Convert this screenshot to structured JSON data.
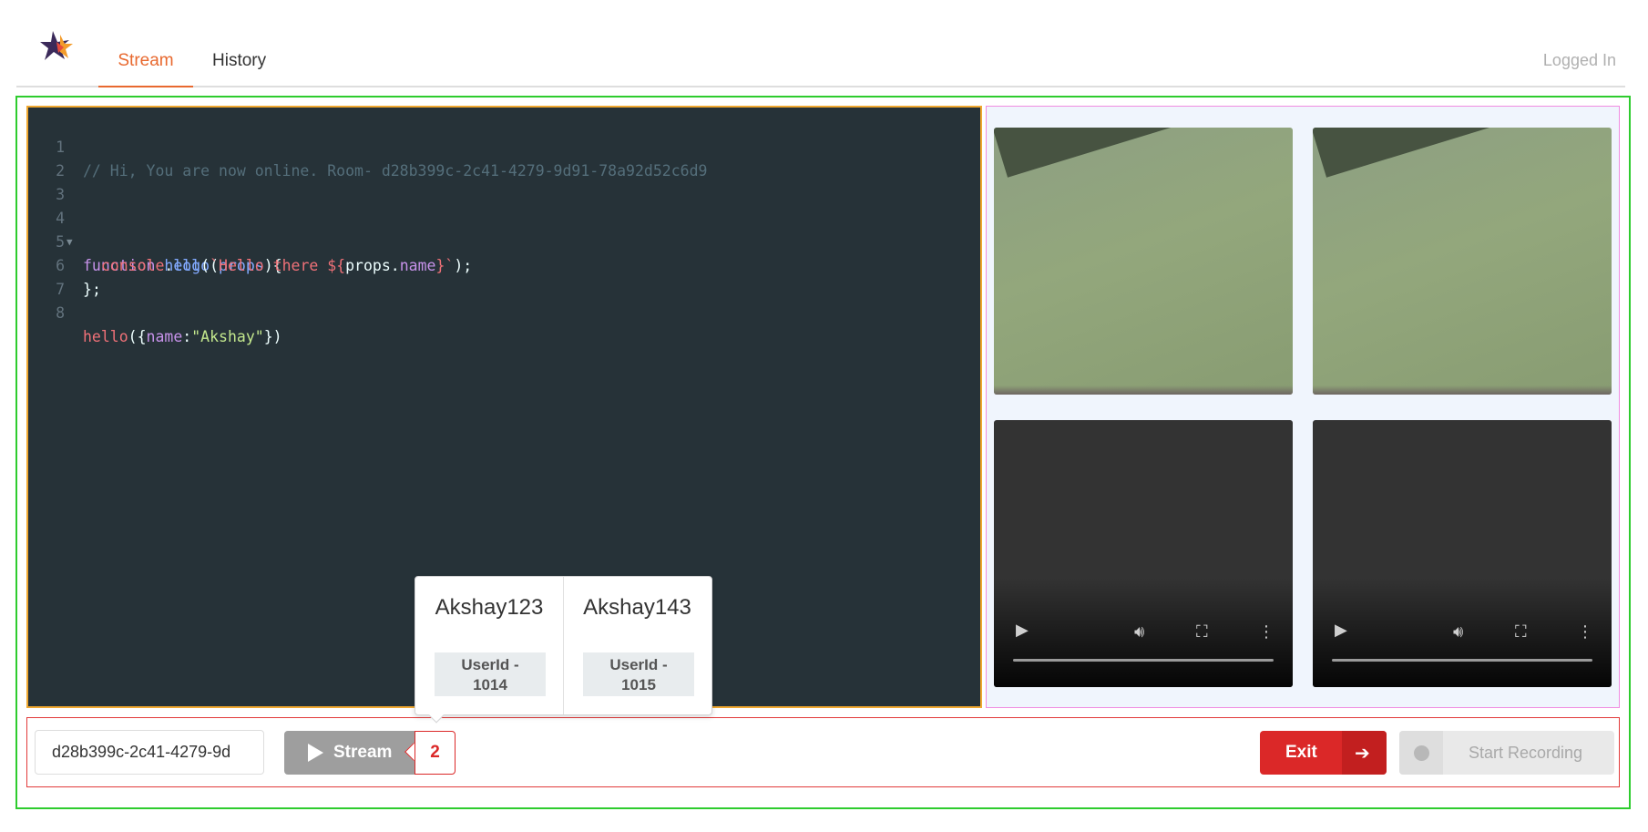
{
  "nav": {
    "tabs": [
      {
        "label": "Stream",
        "active": true
      },
      {
        "label": "History",
        "active": false
      }
    ],
    "status": "Logged In"
  },
  "editor": {
    "lines": [
      {
        "n": "1",
        "text": "// Hi, You are now online. Room- d28b399c-2c41-4279-9d91-78a92d52c6d9"
      },
      {
        "n": "2",
        "text": ""
      },
      {
        "n": "3",
        "text": ""
      },
      {
        "n": "4",
        "text": "function hello(props){"
      },
      {
        "n": "5",
        "text": "  console.log(`Hello there ${props.name}`);"
      },
      {
        "n": "6",
        "text": "};"
      },
      {
        "n": "7",
        "text": ""
      },
      {
        "n": "8",
        "text": "hello({name:\"Akshay\"})"
      }
    ],
    "theme_bg": "#263238"
  },
  "videos": [
    {
      "type": "camera"
    },
    {
      "type": "camera"
    },
    {
      "type": "player"
    },
    {
      "type": "player"
    }
  ],
  "toolbar": {
    "room_input_value": "d28b399c-2c41-4279-9d",
    "stream_label": "Stream",
    "viewer_count": "2",
    "exit_label": "Exit",
    "record_label": "Start Recording"
  },
  "viewers_popup": {
    "users": [
      {
        "name": "Akshay123",
        "id_line1": "UserId -",
        "id_line2": "1014"
      },
      {
        "name": "Akshay143",
        "id_line1": "UserId -",
        "id_line2": "1015"
      }
    ]
  },
  "colors": {
    "accent": "#e8692f",
    "danger": "#db2828",
    "frame": "#2ecc2e",
    "editor_border": "#f0a830"
  },
  "icons": [
    "logo-icon",
    "play-icon",
    "sign-out-icon",
    "record-dot-icon",
    "volume-icon",
    "fullscreen-icon",
    "more-icon"
  ]
}
